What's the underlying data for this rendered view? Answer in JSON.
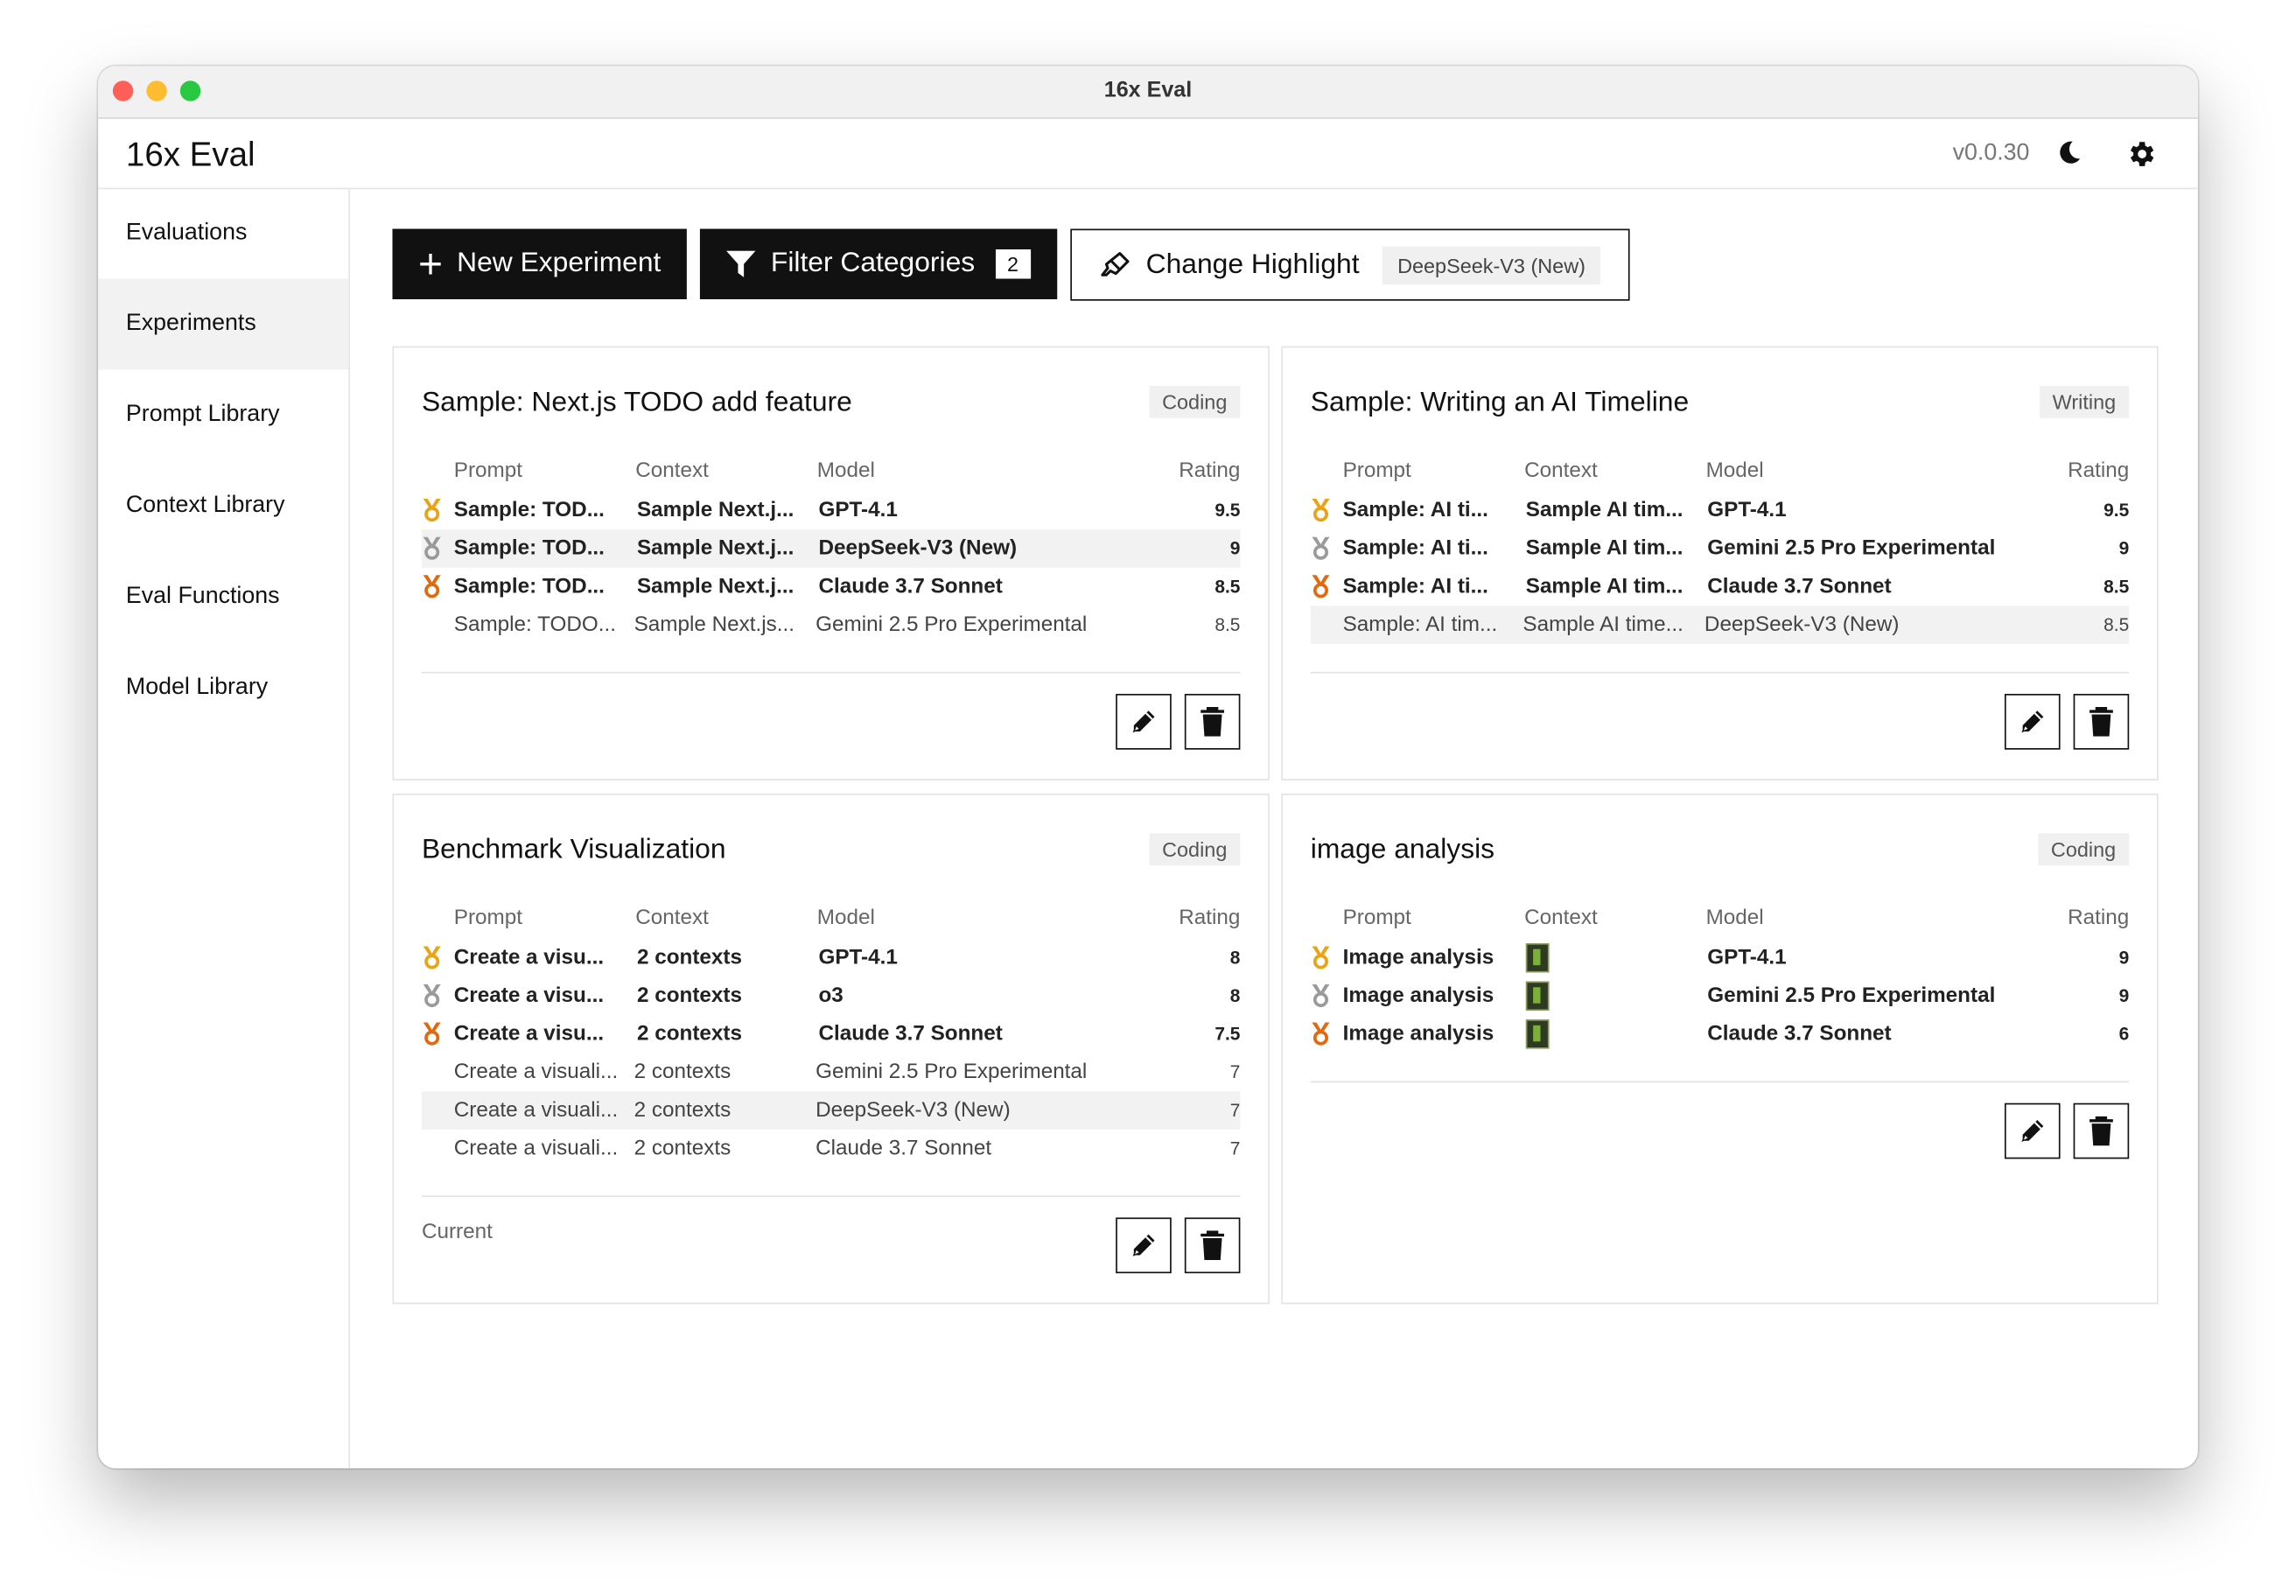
{
  "window": {
    "title": "16x Eval"
  },
  "header": {
    "brand": "16x Eval",
    "version": "v0.0.30"
  },
  "sidebar": {
    "items": [
      {
        "label": "Evaluations"
      },
      {
        "label": "Experiments"
      },
      {
        "label": "Prompt Library"
      },
      {
        "label": "Context Library"
      },
      {
        "label": "Eval Functions"
      },
      {
        "label": "Model Library"
      }
    ]
  },
  "toolbar": {
    "new_label": "New Experiment",
    "filter_label": "Filter Categories",
    "filter_count": "2",
    "highlight_label": "Change Highlight",
    "highlight_value": "DeepSeek-V3 (New)"
  },
  "columns": {
    "prompt": "Prompt",
    "context": "Context",
    "model": "Model",
    "rating": "Rating"
  },
  "colors": {
    "gold": "#e8a317",
    "silver": "#9a9a9a",
    "bronze": "#e06a10"
  },
  "cards": [
    {
      "title": "Sample: Next.js TODO add feature",
      "tag": "Coding",
      "rows": [
        {
          "medal": "gold-medal-icon",
          "prompt": "Sample: TOD...",
          "context": "Sample Next.j...",
          "model": "GPT-4.1",
          "rating": "9.5"
        },
        {
          "medal": "silver-medal-icon",
          "prompt": "Sample: TOD...",
          "context": "Sample Next.j...",
          "model": "DeepSeek-V3 (New)",
          "rating": "9"
        },
        {
          "medal": "bronze-medal-icon",
          "prompt": "Sample: TOD...",
          "context": "Sample Next.j...",
          "model": "Claude 3.7 Sonnet",
          "rating": "8.5"
        },
        {
          "medal": "",
          "prompt": "Sample: TODO...",
          "context": "Sample Next.js...",
          "model": "Gemini 2.5 Pro Experimental",
          "rating": "8.5"
        }
      ]
    },
    {
      "title": "Sample: Writing an AI Timeline",
      "tag": "Writing",
      "rows": [
        {
          "medal": "gold-medal-icon",
          "prompt": "Sample: AI ti...",
          "context": "Sample AI tim...",
          "model": "GPT-4.1",
          "rating": "9.5"
        },
        {
          "medal": "silver-medal-icon",
          "prompt": "Sample: AI ti...",
          "context": "Sample AI tim...",
          "model": "Gemini 2.5 Pro Experimental",
          "rating": "9"
        },
        {
          "medal": "bronze-medal-icon",
          "prompt": "Sample: AI ti...",
          "context": "Sample AI tim...",
          "model": "Claude 3.7 Sonnet",
          "rating": "8.5"
        },
        {
          "medal": "",
          "prompt": "Sample: AI tim...",
          "context": "Sample AI time...",
          "model": "DeepSeek-V3 (New)",
          "rating": "8.5"
        }
      ]
    },
    {
      "title": "Benchmark Visualization",
      "tag": "Coding",
      "footer": "Current",
      "rows": [
        {
          "medal": "gold-medal-icon",
          "prompt": "Create a visu...",
          "context": "2 contexts",
          "model": "GPT-4.1",
          "rating": "8"
        },
        {
          "medal": "silver-medal-icon",
          "prompt": "Create a visu...",
          "context": "2 contexts",
          "model": "o3",
          "rating": "8"
        },
        {
          "medal": "bronze-medal-icon",
          "prompt": "Create a visu...",
          "context": "2 contexts",
          "model": "Claude 3.7 Sonnet",
          "rating": "7.5"
        },
        {
          "medal": "",
          "prompt": "Create a visuali...",
          "context": "2 contexts",
          "model": "Gemini 2.5 Pro Experimental",
          "rating": "7"
        },
        {
          "medal": "",
          "prompt": "Create a visuali...",
          "context": "2 contexts",
          "model": "DeepSeek-V3 (New)",
          "rating": "7"
        },
        {
          "medal": "",
          "prompt": "Create a visuali...",
          "context": "2 contexts",
          "model": "Claude 3.7 Sonnet",
          "rating": "7"
        }
      ]
    },
    {
      "title": "image analysis",
      "tag": "Coding",
      "rows": [
        {
          "medal": "gold-medal-icon",
          "prompt": "Image analysis",
          "context": "image-thumbnail",
          "model": "GPT-4.1",
          "rating": "9"
        },
        {
          "medal": "silver-medal-icon",
          "prompt": "Image analysis",
          "context": "image-thumbnail",
          "model": "Gemini 2.5 Pro Experimental",
          "rating": "9"
        },
        {
          "medal": "bronze-medal-icon",
          "prompt": "Image analysis",
          "context": "image-thumbnail",
          "model": "Claude 3.7 Sonnet",
          "rating": "6"
        }
      ]
    }
  ]
}
